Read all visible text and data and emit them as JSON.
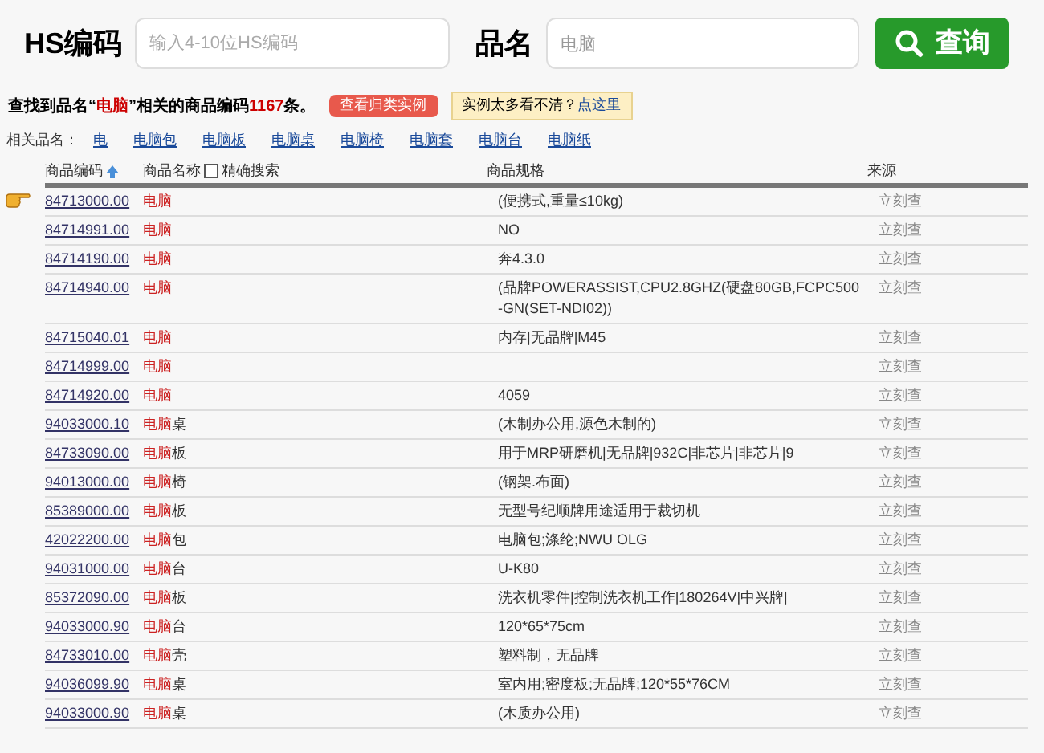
{
  "search": {
    "hs_label": "HS编码",
    "hs_placeholder": "输入4-10位HS编码",
    "name_label": "品名",
    "name_value": "电脑",
    "button": "查询"
  },
  "summary": {
    "prefix": "查找到品名“",
    "keyword": "电脑",
    "middle": "”相关的商品编码",
    "count": "1167",
    "suffix": "条。",
    "examples_button": "查看归类实例",
    "hint_prefix": "实例太多看不清？",
    "hint_link": "点这里"
  },
  "related": {
    "label": "相关品名：",
    "items": [
      "电",
      "电脑包",
      "电脑板",
      "电脑桌",
      "电脑椅",
      "电脑套",
      "电脑台",
      "电脑纸"
    ]
  },
  "table": {
    "columns": [
      "商品编码",
      "商品名称",
      "精确搜索",
      "商品规格",
      "来源"
    ],
    "exact_search": false,
    "rows": [
      {
        "code": "84713000.00",
        "name_match": "电脑",
        "name_rest": "",
        "spec": "(便携式,重量≤10kg)",
        "source": "立刻查",
        "selected": true
      },
      {
        "code": "84714991.00",
        "name_match": "电脑",
        "name_rest": "",
        "spec": "NO",
        "source": "立刻查",
        "selected": false
      },
      {
        "code": "84714190.00",
        "name_match": "电脑",
        "name_rest": "",
        "spec": "奔4.3.0",
        "source": "立刻查",
        "selected": false
      },
      {
        "code": "84714940.00",
        "name_match": "电脑",
        "name_rest": "",
        "spec": "(品牌POWERASSIST,CPU2.8GHZ(硬盘80GB,FCPC500-GN(SET-NDI02))",
        "source": "立刻查",
        "selected": false
      },
      {
        "code": "84715040.01",
        "name_match": "电脑",
        "name_rest": "",
        "spec": "内存|无品牌|M45",
        "source": "立刻查",
        "selected": false
      },
      {
        "code": "84714999.00",
        "name_match": "电脑",
        "name_rest": "",
        "source": "立刻查",
        "selected": false
      },
      {
        "code": "84714920.00",
        "name_match": "电脑",
        "name_rest": "",
        "spec": "4059",
        "source": "立刻查",
        "selected": false
      },
      {
        "code": "94033000.10",
        "name_match": "电脑",
        "name_rest": "桌",
        "spec": "(木制办公用,源色木制的)",
        "source": "立刻查",
        "selected": false
      },
      {
        "code": "84733090.00",
        "name_match": "电脑",
        "name_rest": "板",
        "spec": "用于MRP研磨机|无品牌|932C|非芯片|非芯片|9",
        "source": "立刻查",
        "selected": false
      },
      {
        "code": "94013000.00",
        "name_match": "电脑",
        "name_rest": "椅",
        "spec": "(钢架.布面)",
        "source": "立刻查",
        "selected": false
      },
      {
        "code": "85389000.00",
        "name_match": "电脑",
        "name_rest": "板",
        "spec": "无型号纪顺牌用途适用于裁切机",
        "source": "立刻查",
        "selected": false
      },
      {
        "code": "42022200.00",
        "name_match": "电脑",
        "name_rest": "包",
        "spec": "电脑包;涤纶;NWU OLG",
        "source": "立刻查",
        "selected": false
      },
      {
        "code": "94031000.00",
        "name_match": "电脑",
        "name_rest": "台",
        "spec": "U-K80",
        "source": "立刻查",
        "selected": false
      },
      {
        "code": "85372090.00",
        "name_match": "电脑",
        "name_rest": "板",
        "spec": "洗衣机零件|控制洗衣机工作|180264V|中兴牌|",
        "source": "立刻查",
        "selected": false
      },
      {
        "code": "94033000.90",
        "name_match": "电脑",
        "name_rest": "台",
        "spec": "120*65*75cm",
        "source": "立刻查",
        "selected": false
      },
      {
        "code": "84733010.00",
        "name_match": "电脑",
        "name_rest": "壳",
        "spec": "塑料制，无品牌",
        "source": "立刻查",
        "selected": false
      },
      {
        "code": "94036099.90",
        "name_match": "电脑",
        "name_rest": "桌",
        "spec": "室内用;密度板;无品牌;120*55*76CM",
        "source": "立刻查",
        "selected": false
      },
      {
        "code": "94033000.90",
        "name_match": "电脑",
        "name_rest": "桌",
        "spec": "(木质办公用)",
        "source": "立刻查",
        "selected": false
      }
    ]
  }
}
